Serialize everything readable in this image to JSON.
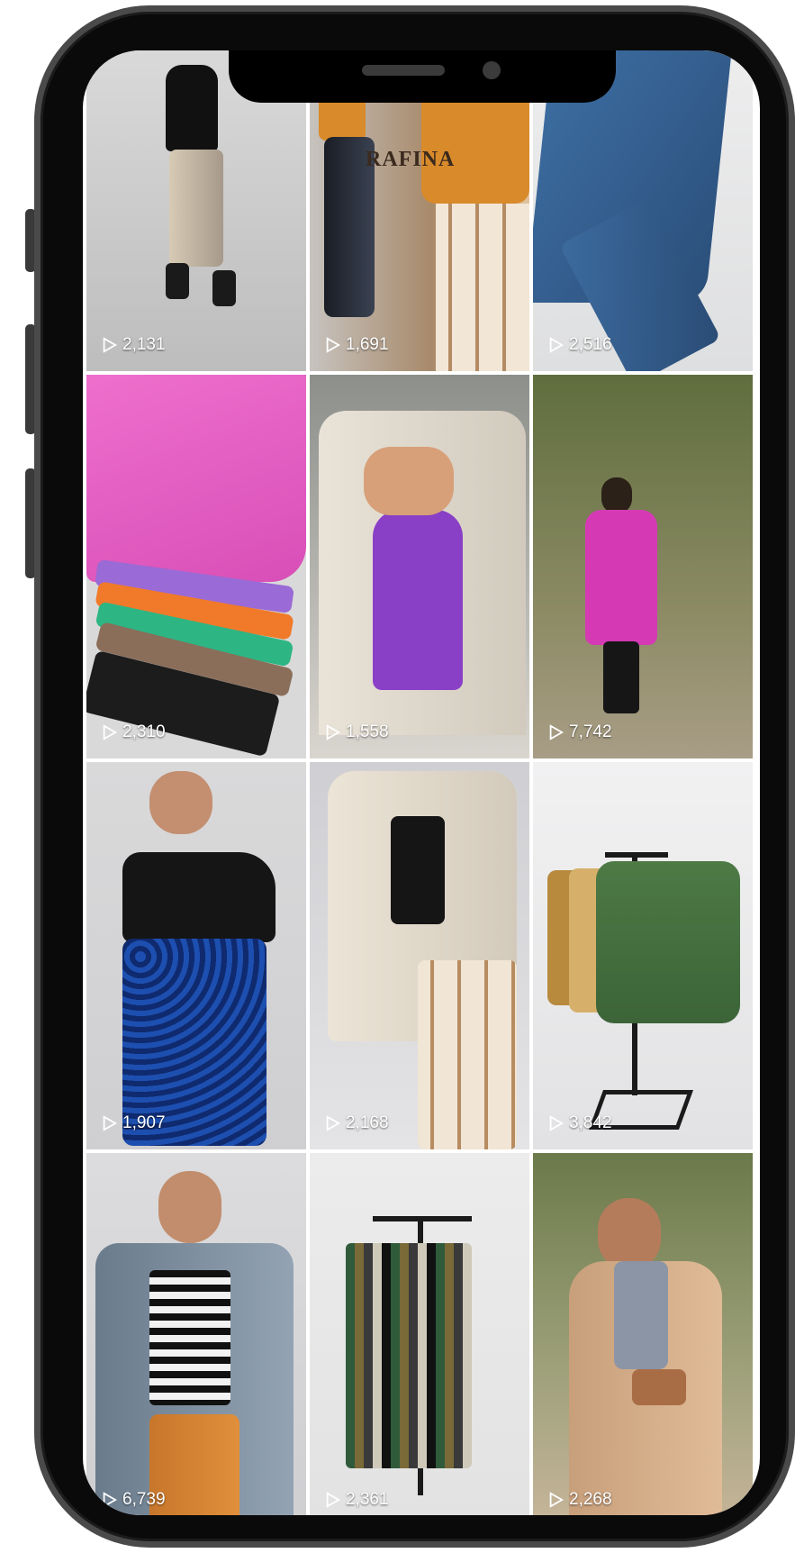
{
  "colors": {
    "frame": "#0a0a0a",
    "bezel": "#4a4a4a",
    "count_text": "#ffffff"
  },
  "feed": {
    "tiles": [
      {
        "id": "t1",
        "views": "2,131"
      },
      {
        "id": "t2",
        "views": "1,691",
        "brand": "RAFINA"
      },
      {
        "id": "t3",
        "views": "2,516"
      },
      {
        "id": "t4",
        "views": "2,310"
      },
      {
        "id": "t5",
        "views": "1,558"
      },
      {
        "id": "t6",
        "views": "7,742"
      },
      {
        "id": "t7",
        "views": "1,907"
      },
      {
        "id": "t8",
        "views": "2,168"
      },
      {
        "id": "t9",
        "views": "3,842"
      },
      {
        "id": "t10",
        "views": "6,739"
      },
      {
        "id": "t11",
        "views": "2,361"
      },
      {
        "id": "t12",
        "views": "2,268"
      }
    ]
  },
  "icons": {
    "view_count": "play-icon"
  }
}
